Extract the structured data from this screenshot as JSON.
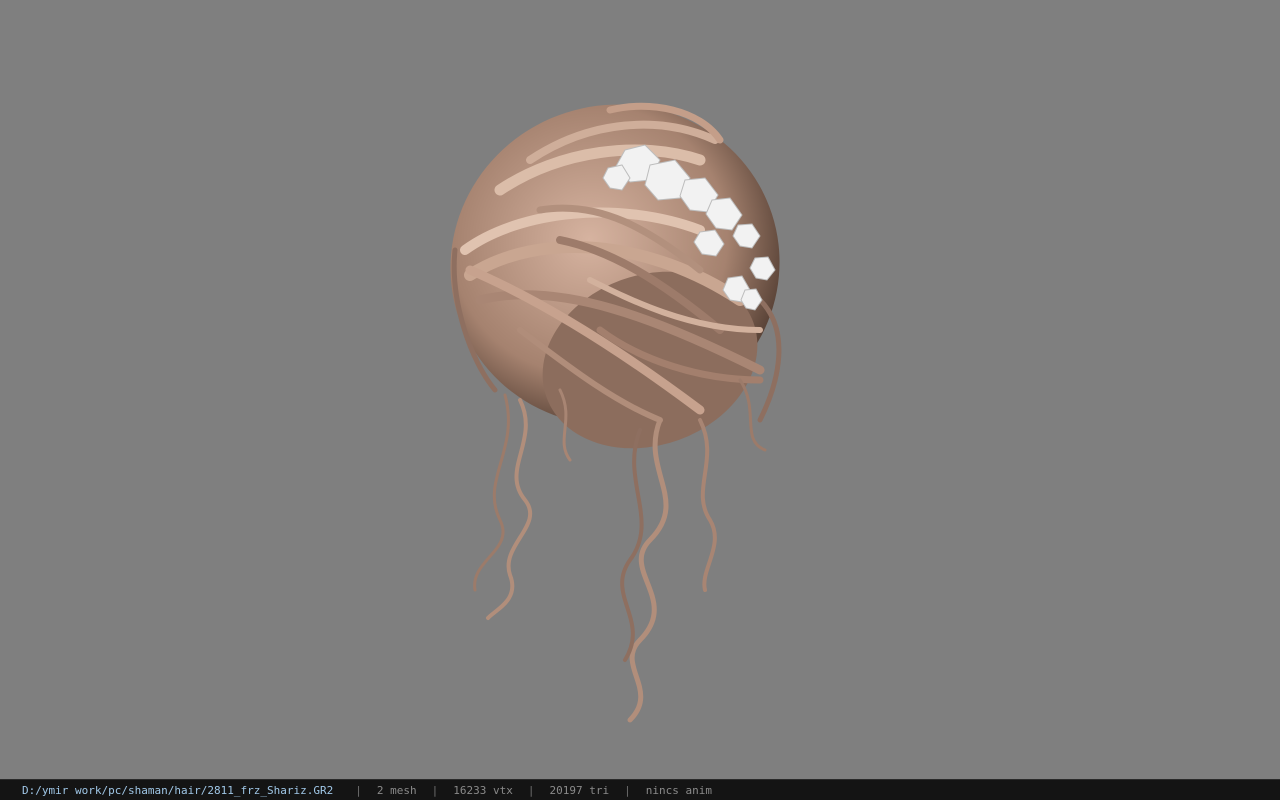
{
  "viewport": {
    "background": "#7f7f7f",
    "model": "hair-mesh-with-flowers",
    "hair_color": "#b8927e",
    "flower_color": "#f2f2f2"
  },
  "status": {
    "path": "D:/ymir work/pc/shaman/hair/2811_frz_Shariz.GR2",
    "mesh": "2 mesh",
    "vtx": "16233 vtx",
    "tri": "20197 tri",
    "anim": "nincs anim",
    "separator": "|"
  }
}
